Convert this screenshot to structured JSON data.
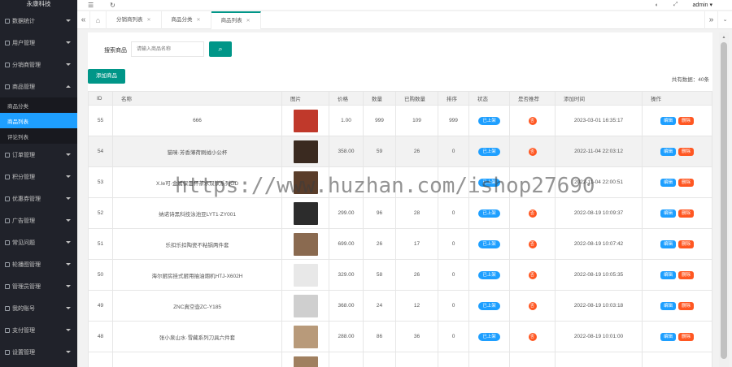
{
  "app": {
    "logo_text": "永康科技"
  },
  "header": {
    "admin_label": "admin"
  },
  "sidebar": {
    "items_before": [
      {
        "label": "数据统计"
      },
      {
        "label": "用户管理"
      },
      {
        "label": "分销商管理"
      },
      {
        "label": "商品管理"
      }
    ],
    "sub_items": [
      {
        "label": "商品分类",
        "active": false
      },
      {
        "label": "商品列表",
        "active": true
      },
      {
        "label": "评论列表",
        "active": false
      }
    ],
    "items_after": [
      {
        "label": "订单管理"
      },
      {
        "label": "积分管理"
      },
      {
        "label": "优惠券管理"
      },
      {
        "label": "广告管理"
      },
      {
        "label": "常见问题"
      },
      {
        "label": "轮播图管理"
      },
      {
        "label": "管理员管理"
      },
      {
        "label": "我的账号"
      },
      {
        "label": "支付管理"
      },
      {
        "label": "设置管理"
      }
    ]
  },
  "tabs": [
    {
      "label": "分销商列表",
      "active": false
    },
    {
      "label": "商品分类",
      "active": false
    },
    {
      "label": "商品列表",
      "active": true
    }
  ],
  "search": {
    "label": "搜索商品",
    "placeholder": "请输入商品名称"
  },
  "toolbar": {
    "add_label": "添加商品",
    "total_text": "共有数据：40条"
  },
  "table": {
    "headers": [
      "ID",
      "名称",
      "图片",
      "价格",
      "数量",
      "已购数量",
      "排序",
      "状态",
      "是否推荐",
      "添加时间",
      "操作"
    ],
    "edit_label": "编辑",
    "delete_label": "删除",
    "rows": [
      {
        "id": "55",
        "name": "666",
        "price": "1.00",
        "qty": "999",
        "sold": "109",
        "sort": "999",
        "status": "已上架",
        "rec": "否",
        "time": "2023-03-01 16:35:17",
        "img": "#c0392b",
        "hl": false
      },
      {
        "id": "54",
        "name": "猫咪·芳香薄荷刷绒小公杯",
        "price": "358.00",
        "qty": "59",
        "sold": "26",
        "sort": "0",
        "status": "已上架",
        "rec": "否",
        "time": "2022-11-04 22:03:12",
        "img": "#3a2a20",
        "hl": true
      },
      {
        "id": "53",
        "name": "X.le可·金属保温杯茶水双饮系列GD",
        "price": "",
        "qty": "",
        "sold": "",
        "sort": "",
        "status": "已上架",
        "rec": "",
        "time": "2022-11-04 22:00:51",
        "img": "#5a3d2a",
        "hl": false
      },
      {
        "id": "52",
        "name": "纳诺诗黑科技泳池亚LYT1·ZY001",
        "price": "299.00",
        "qty": "96",
        "sold": "28",
        "sort": "0",
        "status": "已上架",
        "rec": "否",
        "time": "2022-08-19 10:09:37",
        "img": "#2c2c2c",
        "hl": false
      },
      {
        "id": "51",
        "name": "乐扣乐扣陶瓷不粘锅两件套",
        "price": "699.00",
        "qty": "26",
        "sold": "17",
        "sort": "0",
        "status": "已上架",
        "rec": "否",
        "time": "2022-08-19 10:07:42",
        "img": "#8a6a50",
        "hl": false
      },
      {
        "id": "50",
        "name": "海尔厨房挂式厨用抽油烟机HTJ-X602H",
        "price": "329.00",
        "qty": "58",
        "sold": "26",
        "sort": "0",
        "status": "已上架",
        "rec": "否",
        "time": "2022-08-19 10:05:35",
        "img": "#e8e8e8",
        "hl": false
      },
      {
        "id": "49",
        "name": "ZNC真空壶ZC-Y185",
        "price": "368.00",
        "qty": "24",
        "sold": "12",
        "sort": "0",
        "status": "已上架",
        "rec": "否",
        "time": "2022-08-19 10:03:18",
        "img": "#cfcfcf",
        "hl": false
      },
      {
        "id": "48",
        "name": "张小泉山水·雪藏系列刀具六件套",
        "price": "288.00",
        "qty": "86",
        "sold": "36",
        "sort": "0",
        "status": "已上架",
        "rec": "否",
        "time": "2022-08-19 10:01:00",
        "img": "#b89a7a",
        "hl": false
      },
      {
        "id": "",
        "name": "",
        "price": "",
        "qty": "",
        "sold": "",
        "sort": "",
        "status": "",
        "rec": "",
        "time": "",
        "img": "#a08060",
        "hl": false
      }
    ]
  },
  "watermark": {
    "text": "https://www.huzhan.com/ishop27690"
  }
}
